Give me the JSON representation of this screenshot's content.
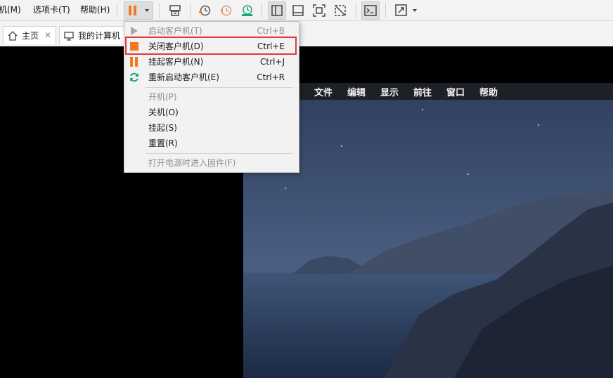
{
  "menubar": {
    "items": [
      "机(M)",
      "选项卡(T)",
      "帮助(H)"
    ]
  },
  "tabs": [
    {
      "label": "主页",
      "icon": "home-icon"
    },
    {
      "label": "我的计算机",
      "icon": "computer-icon"
    }
  ],
  "colors": {
    "accent": "#f07a22",
    "green": "#1aa37f",
    "highlight_border": "#e03a3a"
  },
  "dropdown": {
    "items": [
      {
        "label": "启动客户机(T)",
        "shortcut": "Ctrl+B",
        "enabled": false,
        "icon": "play-icon"
      },
      {
        "label": "关闭客户机(D)",
        "shortcut": "Ctrl+E",
        "enabled": true,
        "icon": "stop-icon",
        "highlighted": true
      },
      {
        "label": "挂起客户机(N)",
        "shortcut": "Ctrl+J",
        "enabled": true,
        "icon": "pause-icon"
      },
      {
        "label": "重新启动客户机(E)",
        "shortcut": "Ctrl+R",
        "enabled": true,
        "icon": "restart-icon"
      },
      {
        "label": "开机(P)",
        "enabled": false
      },
      {
        "label": "关机(O)",
        "enabled": true
      },
      {
        "label": "挂起(S)",
        "enabled": true
      },
      {
        "label": "重置(R)",
        "enabled": true
      },
      {
        "label": "打开电源时进入固件(F)",
        "enabled": false
      }
    ]
  },
  "guest": {
    "menubar": [
      "文件",
      "编辑",
      "显示",
      "前往",
      "窗口",
      "帮助"
    ]
  }
}
